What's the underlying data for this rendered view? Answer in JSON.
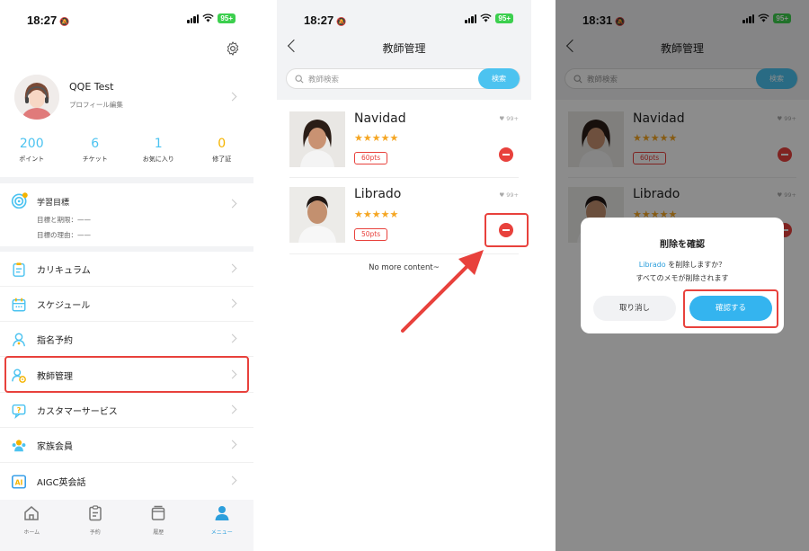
{
  "panel1": {
    "status": {
      "time": "18:27",
      "battery": "95+"
    },
    "profile": {
      "name": "QQE Test",
      "edit_label": "プロフィール編集"
    },
    "stats": [
      {
        "value": "200",
        "label": "ポイント",
        "color": "#4cc3f0"
      },
      {
        "value": "6",
        "label": "チケット",
        "color": "#4cc3f0"
      },
      {
        "value": "1",
        "label": "お気に入り",
        "color": "#4cc3f0"
      },
      {
        "value": "0",
        "label": "修了証",
        "color": "#f5b400"
      }
    ],
    "goal": {
      "title": "学習目標",
      "deadline": "目標と期限：——",
      "reason": "目標の理由：——"
    },
    "menu": [
      {
        "label": "カリキュラム",
        "icon": "curriculum-icon"
      },
      {
        "label": "スケジュール",
        "icon": "calendar-icon"
      },
      {
        "label": "指名予約",
        "icon": "person-icon"
      },
      {
        "label": "教師管理",
        "icon": "teacher-manage-icon"
      },
      {
        "label": "カスタマーサービス",
        "icon": "chat-question-icon"
      },
      {
        "label": "家族会員",
        "icon": "family-icon"
      },
      {
        "label": "AIGC英会話",
        "icon": "ai-icon"
      }
    ],
    "tabs": [
      {
        "label": "ホーム",
        "icon": "home-icon"
      },
      {
        "label": "予約",
        "icon": "clipboard-icon"
      },
      {
        "label": "履歴",
        "icon": "history-icon"
      },
      {
        "label": "メニュー",
        "icon": "user-icon",
        "active": true
      }
    ]
  },
  "panel2": {
    "status": {
      "time": "18:27",
      "battery": "95+"
    },
    "title": "教師管理",
    "search": {
      "placeholder": "教師検索",
      "button": "検索"
    },
    "teachers": [
      {
        "name": "Navidad",
        "stars": "★★★★★",
        "points": "60pts",
        "likes": "♥ 99+"
      },
      {
        "name": "Librado",
        "stars": "★★★★★",
        "points": "50pts",
        "likes": "♥ 99+"
      }
    ],
    "footer": "No more content~"
  },
  "panel3": {
    "status": {
      "time": "18:31",
      "battery": "95+"
    },
    "title": "教師管理",
    "search": {
      "placeholder": "教師検索",
      "button": "検索"
    },
    "teachers": [
      {
        "name": "Navidad",
        "stars": "★★★★★",
        "points": "60pts",
        "likes": "♥ 99+"
      },
      {
        "name": "Librado",
        "stars": "★★★★★",
        "likes": "♥ 99+"
      }
    ],
    "dialog": {
      "title": "削除を確認",
      "teacher_name": "Librado",
      "message_suffix": " を削除しますか？",
      "message_line2": "すべてのメモが削除されます",
      "cancel": "取り消し",
      "confirm": "確認する"
    }
  },
  "colors": {
    "accent": "#4cc3f0",
    "highlight": "#e8413c",
    "star": "#f5a623"
  }
}
